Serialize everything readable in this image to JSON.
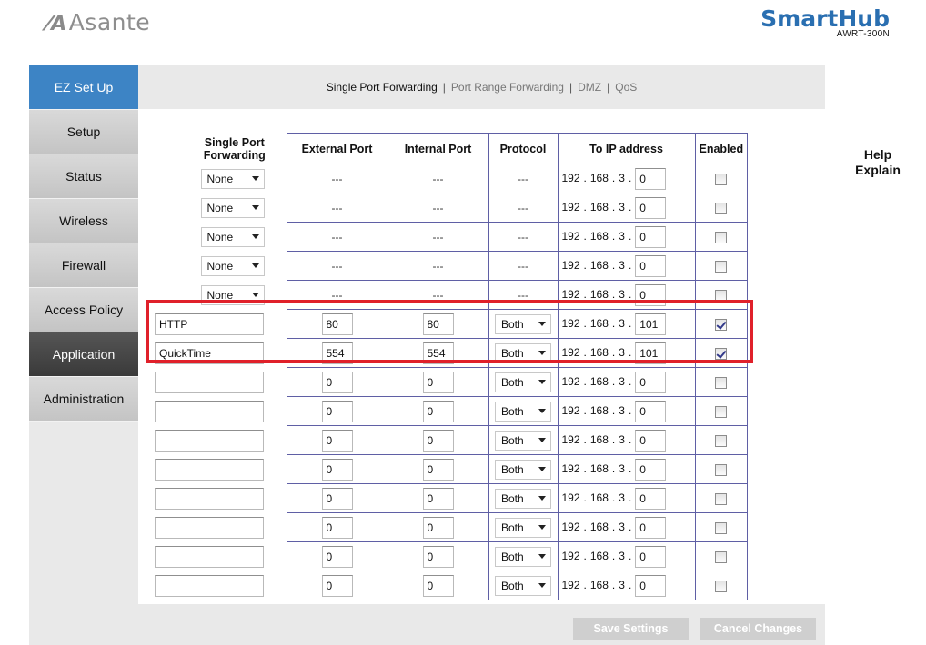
{
  "header": {
    "logo_text": "Asante",
    "logo_mark": "⁄A",
    "brand_name": "SmartHub",
    "brand_model": "AWRT-300N"
  },
  "sidebar": {
    "items": [
      {
        "label": "EZ Set Up"
      },
      {
        "label": "Setup"
      },
      {
        "label": "Status"
      },
      {
        "label": "Wireless"
      },
      {
        "label": "Firewall"
      },
      {
        "label": "Access Policy"
      },
      {
        "label": "Application"
      },
      {
        "label": "Administration"
      }
    ]
  },
  "tabs": {
    "single": "Single Port Forwarding",
    "range": "Port Range Forwarding",
    "dmz": "DMZ",
    "qos": "QoS",
    "separator": "|"
  },
  "help": {
    "line1": "Help",
    "line2": "Explain"
  },
  "table": {
    "headers": {
      "app_line1": "Single Port",
      "app_line2": "Forwarding",
      "external": "External Port",
      "internal": "Internal Port",
      "protocol": "Protocol",
      "ip": "To IP address",
      "enabled": "Enabled"
    },
    "ip_prefix": [
      "192",
      "168",
      "3"
    ],
    "dot": ".",
    "rows": [
      {
        "app": "None",
        "external": "---",
        "internal": "---",
        "protocol": "---",
        "ip_last": "0",
        "enabled": false
      },
      {
        "app": "None",
        "external": "---",
        "internal": "---",
        "protocol": "---",
        "ip_last": "0",
        "enabled": false
      },
      {
        "app": "None",
        "external": "---",
        "internal": "---",
        "protocol": "---",
        "ip_last": "0",
        "enabled": false
      },
      {
        "app": "None",
        "external": "---",
        "internal": "---",
        "protocol": "---",
        "ip_last": "0",
        "enabled": false
      },
      {
        "app": "None",
        "external": "---",
        "internal": "---",
        "protocol": "---",
        "ip_last": "0",
        "enabled": false
      },
      {
        "app": "HTTP",
        "external": "80",
        "internal": "80",
        "protocol": "Both",
        "ip_last": "101",
        "enabled": true
      },
      {
        "app": "QuickTime",
        "external": "554",
        "internal": "554",
        "protocol": "Both",
        "ip_last": "101",
        "enabled": true
      },
      {
        "app": "",
        "external": "0",
        "internal": "0",
        "protocol": "Both",
        "ip_last": "0",
        "enabled": false
      },
      {
        "app": "",
        "external": "0",
        "internal": "0",
        "protocol": "Both",
        "ip_last": "0",
        "enabled": false
      },
      {
        "app": "",
        "external": "0",
        "internal": "0",
        "protocol": "Both",
        "ip_last": "0",
        "enabled": false
      },
      {
        "app": "",
        "external": "0",
        "internal": "0",
        "protocol": "Both",
        "ip_last": "0",
        "enabled": false
      },
      {
        "app": "",
        "external": "0",
        "internal": "0",
        "protocol": "Both",
        "ip_last": "0",
        "enabled": false
      },
      {
        "app": "",
        "external": "0",
        "internal": "0",
        "protocol": "Both",
        "ip_last": "0",
        "enabled": false
      },
      {
        "app": "",
        "external": "0",
        "internal": "0",
        "protocol": "Both",
        "ip_last": "0",
        "enabled": false
      },
      {
        "app": "",
        "external": "0",
        "internal": "0",
        "protocol": "Both",
        "ip_last": "0",
        "enabled": false
      }
    ]
  },
  "buttons": {
    "save": "Save Settings",
    "cancel": "Cancel Changes"
  },
  "colors": {
    "sidebar_active": "#3d84c5",
    "brand": "#2a6fb1",
    "highlight": "#e0202a",
    "table_border": "#5f5fa5"
  }
}
